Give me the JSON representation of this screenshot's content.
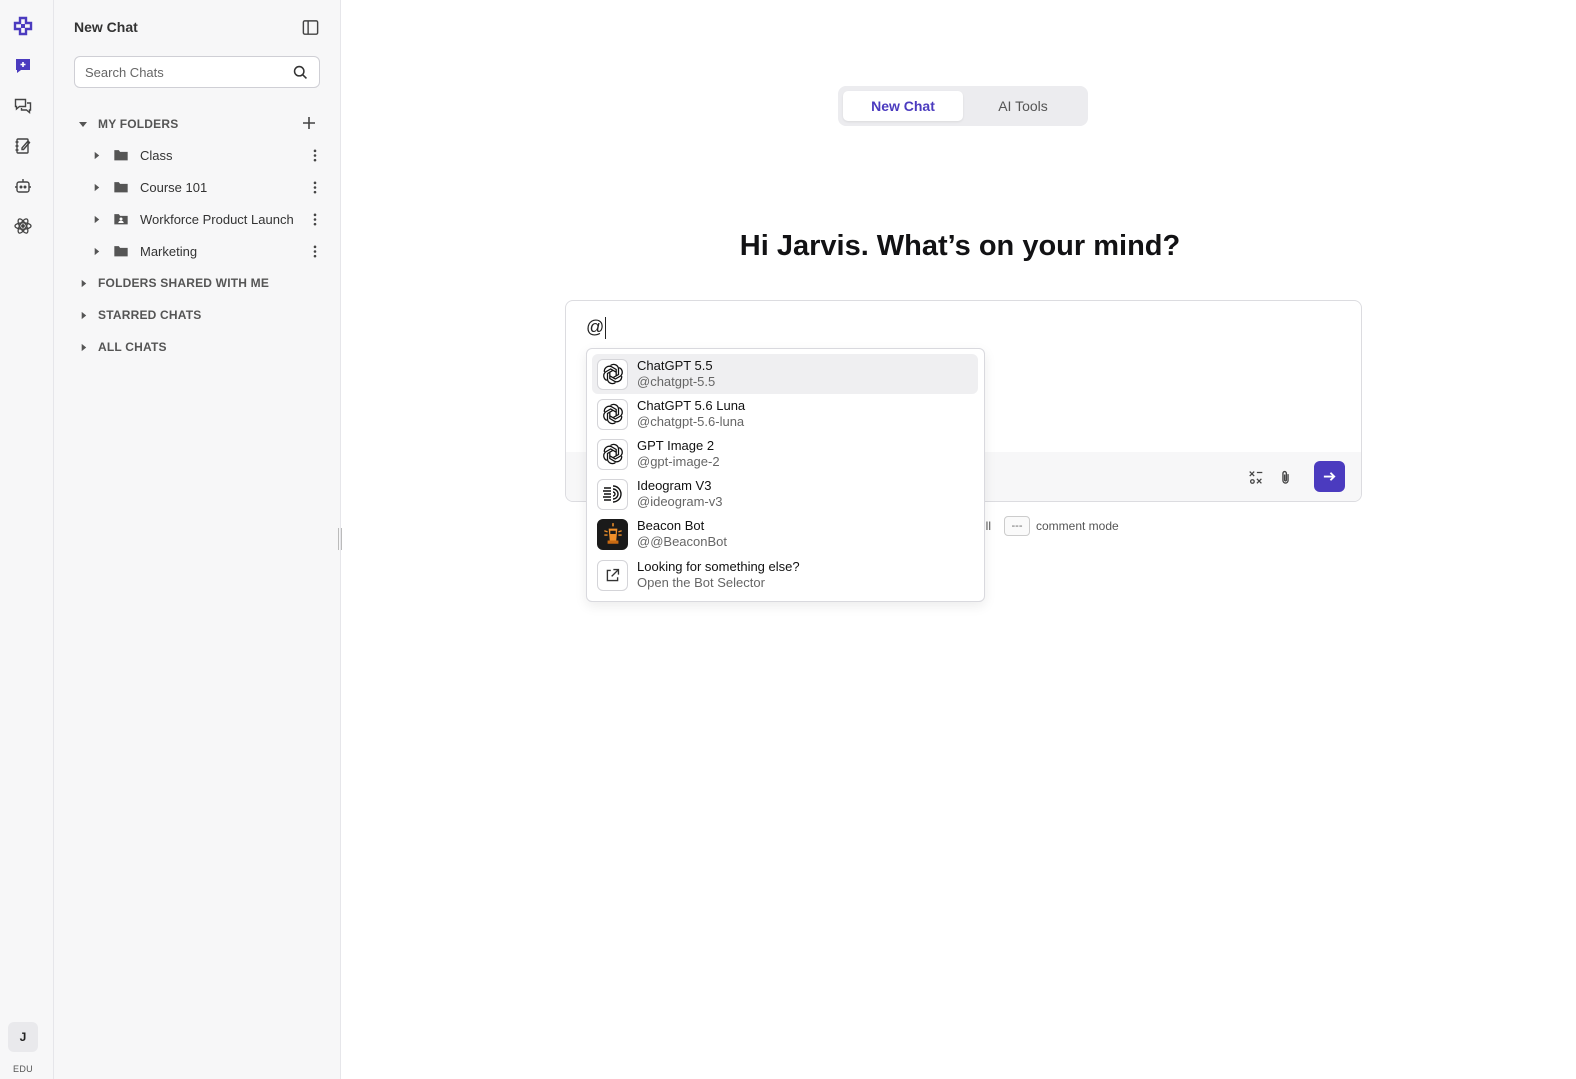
{
  "sidebar": {
    "title": "New Chat",
    "search_placeholder": "Search Chats",
    "sections": {
      "my_folders": "MY FOLDERS",
      "shared": "FOLDERS SHARED WITH ME",
      "starred": "STARRED CHATS",
      "all": "ALL CHATS"
    },
    "folders": [
      {
        "name": "Class",
        "icon": "folder-icon"
      },
      {
        "name": "Course 101",
        "icon": "folder-icon"
      },
      {
        "name": "Workforce Product Launch",
        "icon": "shared-folder-icon"
      },
      {
        "name": "Marketing",
        "icon": "folder-icon"
      }
    ]
  },
  "rail": {
    "icons": [
      "logo-icon",
      "new-chat-icon",
      "chats-icon",
      "notebook-icon",
      "bot-icon",
      "atom-icon"
    ],
    "avatar_initial": "J",
    "plan": "EDU"
  },
  "tabs": [
    {
      "label": "New Chat",
      "active": true
    },
    {
      "label": "AI Tools",
      "active": false
    }
  ],
  "greeting": "Hi Jarvis. What’s on your mind?",
  "composer": {
    "value": "@"
  },
  "hints": {
    "left_fragment": "ill",
    "comment_key": "---",
    "comment_label": "comment mode"
  },
  "mention_menu": {
    "items": [
      {
        "name": "ChatGPT 5.5",
        "handle": "@chatgpt-5.5",
        "icon": "openai-icon"
      },
      {
        "name": "ChatGPT 5.6 Luna",
        "handle": "@chatgpt-5.6-luna",
        "icon": "openai-icon"
      },
      {
        "name": "GPT Image 2",
        "handle": "@gpt-image-2",
        "icon": "openai-icon"
      },
      {
        "name": "Ideogram V3",
        "handle": "@ideogram-v3",
        "icon": "ideogram-icon"
      },
      {
        "name": "Beacon Bot",
        "handle": "@@BeaconBot",
        "icon": "beacon-bot-icon"
      },
      {
        "name": "Looking for something else?",
        "handle": "Open the Bot Selector",
        "icon": "external-link-icon"
      }
    ]
  },
  "colors": {
    "accent": "#4b3bbf",
    "rail_bg": "#f7f7f8"
  }
}
